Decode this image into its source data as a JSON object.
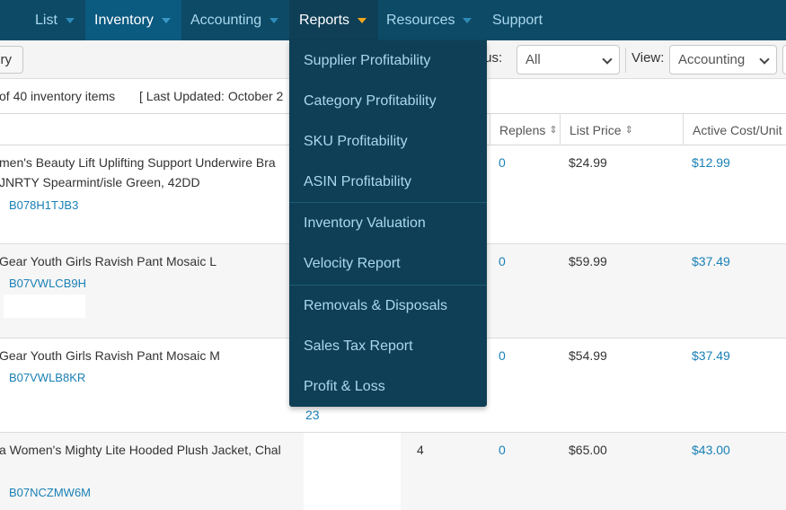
{
  "nav": {
    "items": [
      {
        "label": "List"
      },
      {
        "label": "Inventory"
      },
      {
        "label": "Accounting"
      },
      {
        "label": "Reports"
      },
      {
        "label": "Resources"
      },
      {
        "label": "Support"
      }
    ]
  },
  "reports_menu": {
    "items": [
      {
        "label": "Supplier Profitability"
      },
      {
        "label": "Category Profitability"
      },
      {
        "label": "SKU Profitability"
      },
      {
        "label": "ASIN Profitability"
      },
      {
        "label": "Inventory Valuation"
      },
      {
        "label": "Velocity Report"
      },
      {
        "label": "Removals & Disposals"
      },
      {
        "label": "Sales Tax Report"
      },
      {
        "label": "Profit & Loss"
      }
    ]
  },
  "toolbar": {
    "history_label": "ry",
    "status_label": "tus:",
    "status_value": "All",
    "view_label": "View:",
    "view_value": "Accounting"
  },
  "status": {
    "count_text": "of 40 inventory items",
    "updated_text": "[ Last Updated: October 2"
  },
  "table": {
    "headers": {
      "replens": "Replens",
      "list_price": "List Price",
      "active_cost": "Active Cost/Unit"
    },
    "rows": [
      {
        "title_line1": "men's Beauty Lift Uplifting Support Underwire Bra",
        "title_line2": "JNRTY Spearmint/isle Green, 42DD",
        "asin": "B078H1TJB3",
        "qty": "",
        "replens": "0",
        "list_price": "$24.99",
        "active_cost": "$12.99"
      },
      {
        "title_line1": "Gear Youth Girls Ravish Pant Mosaic L",
        "title_line2": "",
        "asin": "B07VWLCB9H",
        "qty": "",
        "replens": "0",
        "list_price": "$59.99",
        "active_cost": "$37.49"
      },
      {
        "title_line1": "Gear Youth Girls Ravish Pant Mosaic M",
        "title_line2": "",
        "asin": "B07VWLB8KR",
        "qty": "",
        "replens": "0",
        "list_price": "$54.99",
        "active_cost": "$37.49",
        "extra": "23"
      },
      {
        "title_line1": "a Women's Mighty Lite Hooded Plush Jacket, Chal",
        "title_line2": "",
        "asin": "B07NCZMW6M",
        "qty": "4",
        "replens": "0",
        "list_price": "$65.00",
        "active_cost": "$43.00"
      }
    ]
  }
}
